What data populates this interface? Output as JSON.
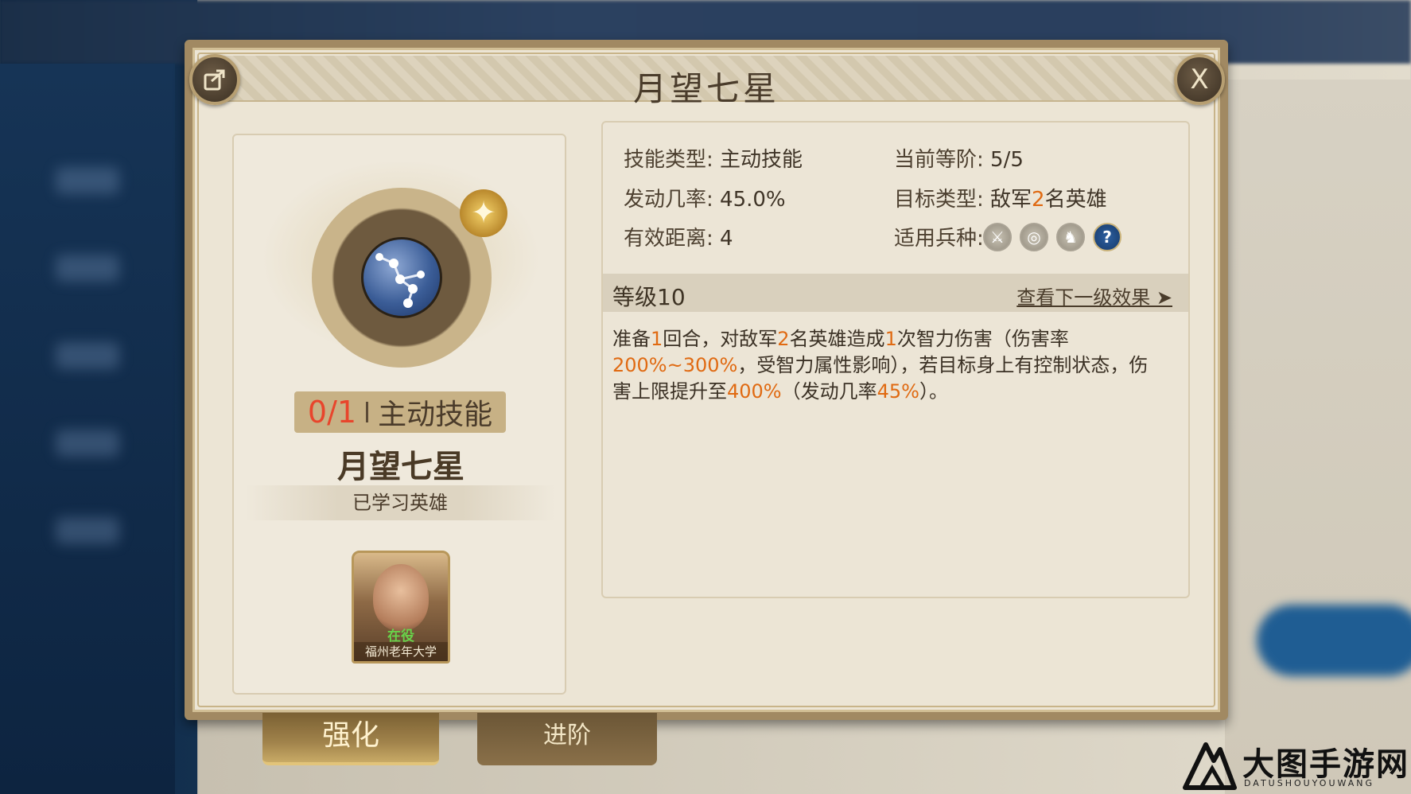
{
  "dialog": {
    "title": "月望七星",
    "share_icon": "share-icon",
    "close_label": "X"
  },
  "skill_card": {
    "count": "0/1",
    "type": "主动技能",
    "name": "月望七星",
    "learned_heroes_label": "已学习英雄",
    "star_icon": "star-icon",
    "hero": {
      "status": "在役",
      "owner": "福州老年大学"
    }
  },
  "info": {
    "skill_type_label": "技能类型:",
    "skill_type_value": "主动技能",
    "current_rank_label": "当前等阶:",
    "current_rank_value": "5/5",
    "trigger_rate_label": "发动几率:",
    "trigger_rate_value": "45.0%",
    "target_type_label": "目标类型:",
    "target_type_prefix": "敌军",
    "target_type_count": "2",
    "target_type_suffix": "名英雄",
    "range_label": "有效距离:",
    "range_value": "4",
    "unit_types_label": "适用兵种:",
    "unit_icons": [
      "infantry-icon",
      "archer-icon",
      "cavalry-icon",
      "question-icon"
    ]
  },
  "level": {
    "label": "等级10",
    "next_link": "查看下一级效果 ➤"
  },
  "description": {
    "p1": "准备",
    "n1": "1",
    "p2": "回合，对敌军",
    "n2": "2",
    "p3": "名英雄造成",
    "n3": "1",
    "p4": "次智力伤害（伤害率",
    "n4": "200%~300%",
    "p5": "，受智力属性影响），若目标身上有控制状态，伤害上限提升至",
    "n5": "400%",
    "p6": "（发动几率",
    "n6": "45%",
    "p7": "）。"
  },
  "tabs": {
    "strengthen": "强化",
    "advance": "进阶"
  },
  "watermark": {
    "title": "大图手游网",
    "subtitle": "DATUSHOUYOUWANG"
  },
  "colors": {
    "highlight": "#e06a12",
    "count_red": "#e8452c",
    "frame_gold": "#a18962"
  }
}
